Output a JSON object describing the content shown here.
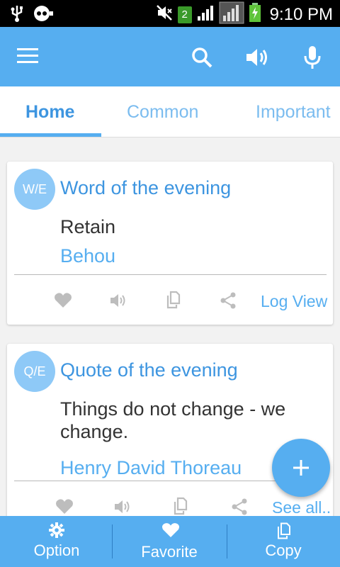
{
  "status_bar": {
    "time": "9:10 PM",
    "notification_badge": "2"
  },
  "app_bar": {
    "icons": [
      "menu-icon",
      "search-icon",
      "speaker-icon",
      "mic-icon"
    ]
  },
  "tabs": [
    {
      "label": "Home",
      "active": true
    },
    {
      "label": "Common",
      "active": false
    },
    {
      "label": "Important",
      "active": false
    }
  ],
  "cards": [
    {
      "avatar": "W/E",
      "title": "Word of the evening",
      "main": "Retain",
      "sub": "Behou",
      "link": "Log View"
    },
    {
      "avatar": "Q/E",
      "title": "Quote of the evening",
      "main_line1": "Things do not change - we",
      "main_line2": "change.",
      "sub": "Henry David Thoreau",
      "link": "See all.."
    }
  ],
  "bottom_bar": {
    "items": [
      {
        "label": "Option",
        "icon": "gear-icon"
      },
      {
        "label": "Favorite",
        "icon": "heart-icon"
      },
      {
        "label": "Copy",
        "icon": "copy-icon"
      }
    ]
  },
  "colors": {
    "primary": "#56aef0",
    "primary_dark": "#3d95e0",
    "avatar": "#8ec9f7"
  }
}
